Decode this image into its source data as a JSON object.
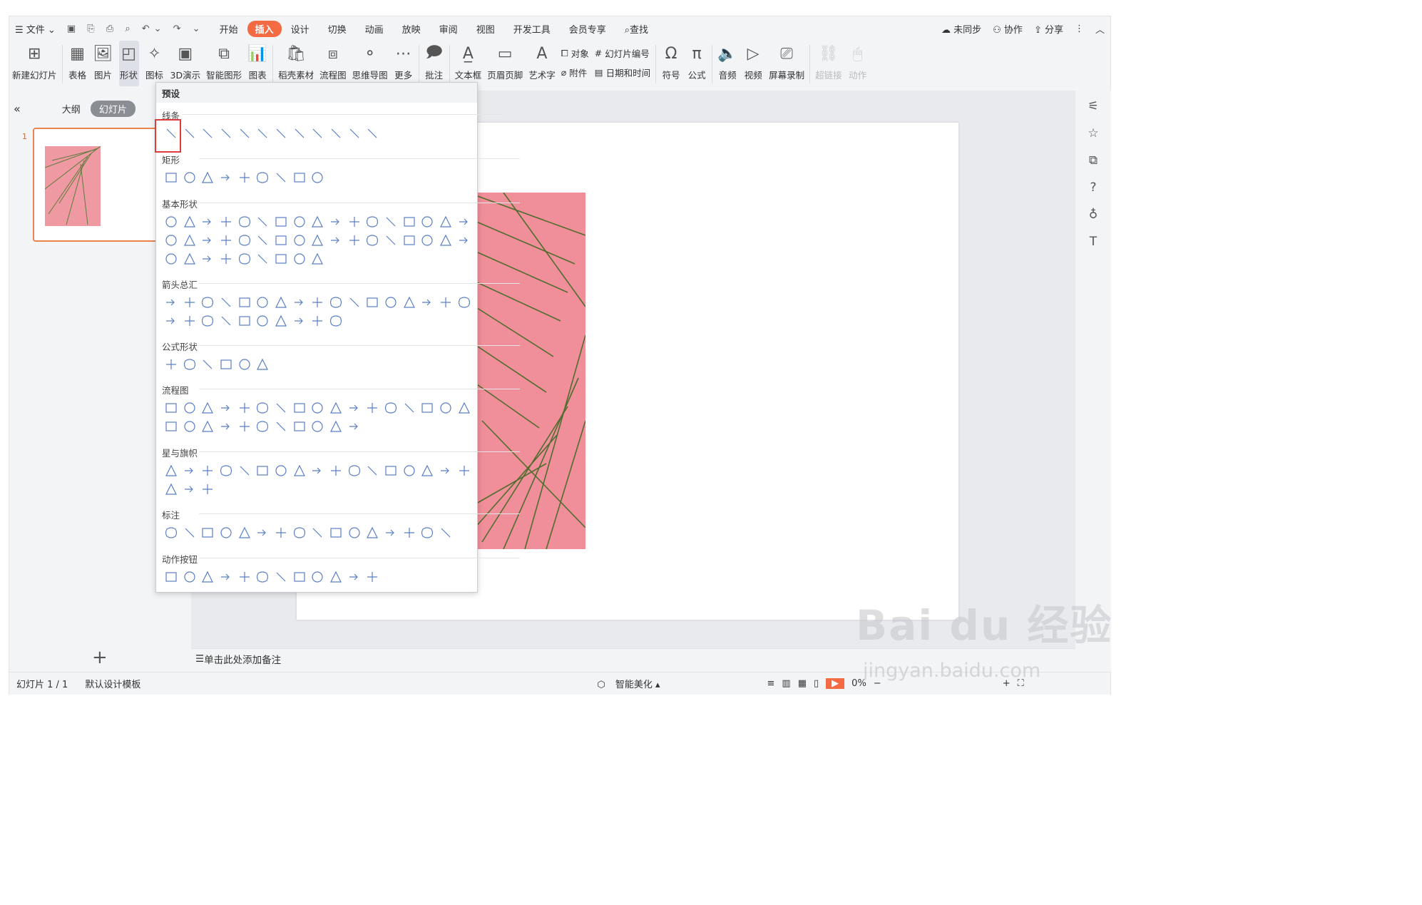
{
  "menubar": {
    "file": "文件",
    "tabs": [
      "开始",
      "插入",
      "设计",
      "切换",
      "动画",
      "放映",
      "审阅",
      "视图",
      "开发工具",
      "会员专享"
    ],
    "search": "查找",
    "sync": "未同步",
    "collab": "协作",
    "share": "分享"
  },
  "ribbon": {
    "new_slide": "新建幻灯片",
    "table": "表格",
    "picture": "图片",
    "shape": "形状",
    "icon": "图标",
    "demo3d": "3D演示",
    "smart": "智能图形",
    "chart": "图表",
    "daoke": "稻壳素材",
    "flow": "流程图",
    "mind": "思维导图",
    "more": "更多",
    "comment": "批注",
    "textbox": "文本框",
    "header": "页眉页脚",
    "art": "艺术字",
    "object": "对象",
    "attach": "附件",
    "slide_no": "幻灯片编号",
    "datetime": "日期和时间",
    "symbol": "符号",
    "formula": "公式",
    "audio": "音频",
    "video": "视频",
    "record": "屏幕录制",
    "hyperlink": "超链接",
    "action": "动作"
  },
  "leftpanel": {
    "outline": "大纲",
    "slides": "幻灯片",
    "slide_num": "1"
  },
  "dropdown": {
    "preset": "预设",
    "sections": [
      "线条",
      "矩形",
      "基本形状",
      "箭头总汇",
      "公式形状",
      "流程图",
      "星与旗帜",
      "标注",
      "动作按钮"
    ]
  },
  "notes": "单击此处添加备注",
  "status": {
    "slide": "幻灯片 1 / 1",
    "template": "默认设计模板",
    "beautify": "智能美化",
    "zoom": "0%"
  },
  "watermark": {
    "logo": "Bai du 经验",
    "url": "jingyan.baidu.com"
  },
  "colors": {
    "accent": "#f46a43",
    "shape_stroke": "#5a7fc4",
    "highlight": "#e03b3b"
  }
}
